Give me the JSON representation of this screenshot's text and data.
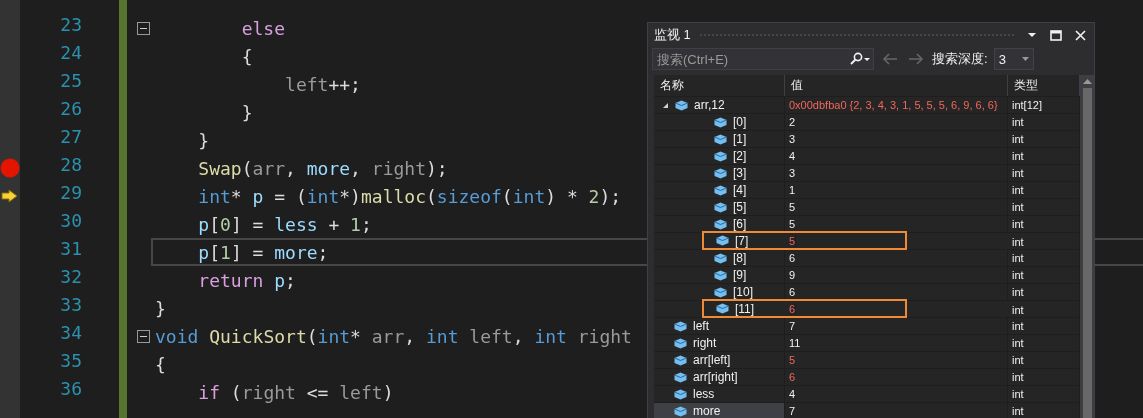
{
  "editor": {
    "lines": [
      {
        "number": "23",
        "breakpoint": false,
        "current": false,
        "focused": false,
        "collapsible": true,
        "tokens": [
          {
            "t": "        else",
            "kind": "ctl"
          }
        ]
      },
      {
        "number": "24",
        "breakpoint": false,
        "current": false,
        "focused": false,
        "collapsible": false,
        "tokens": [
          {
            "t": "        {",
            "kind": "plain"
          }
        ]
      },
      {
        "number": "25",
        "breakpoint": false,
        "current": false,
        "focused": false,
        "collapsible": false,
        "tokens": [
          {
            "t": "            left",
            "kind": "param"
          },
          {
            "t": "++;",
            "kind": "plain"
          }
        ]
      },
      {
        "number": "26",
        "breakpoint": false,
        "current": false,
        "focused": false,
        "collapsible": false,
        "tokens": [
          {
            "t": "        }",
            "kind": "plain"
          }
        ]
      },
      {
        "number": "27",
        "breakpoint": false,
        "current": false,
        "focused": false,
        "collapsible": false,
        "tokens": [
          {
            "t": "    }",
            "kind": "plain"
          }
        ]
      },
      {
        "number": "28",
        "breakpoint": true,
        "current": false,
        "focused": false,
        "collapsible": false,
        "tokens": [
          {
            "t": "    Swap",
            "kind": "fn"
          },
          {
            "t": "(",
            "kind": "plain"
          },
          {
            "t": "arr",
            "kind": "param"
          },
          {
            "t": ", ",
            "kind": "plain"
          },
          {
            "t": "more",
            "kind": "var"
          },
          {
            "t": ", ",
            "kind": "plain"
          },
          {
            "t": "right",
            "kind": "param"
          },
          {
            "t": ");",
            "kind": "plain"
          }
        ]
      },
      {
        "number": "29",
        "breakpoint": false,
        "current": true,
        "focused": false,
        "collapsible": false,
        "tokens": [
          {
            "t": "    int",
            "kind": "kw"
          },
          {
            "t": "* ",
            "kind": "plain"
          },
          {
            "t": "p",
            "kind": "var"
          },
          {
            "t": " = (",
            "kind": "plain"
          },
          {
            "t": "int",
            "kind": "kw"
          },
          {
            "t": "*)",
            "kind": "plain"
          },
          {
            "t": "malloc",
            "kind": "fn"
          },
          {
            "t": "(",
            "kind": "plain"
          },
          {
            "t": "sizeof",
            "kind": "kw"
          },
          {
            "t": "(",
            "kind": "plain"
          },
          {
            "t": "int",
            "kind": "kw"
          },
          {
            "t": ") * ",
            "kind": "plain"
          },
          {
            "t": "2",
            "kind": "num"
          },
          {
            "t": ");",
            "kind": "plain"
          }
        ]
      },
      {
        "number": "30",
        "breakpoint": false,
        "current": false,
        "focused": false,
        "collapsible": false,
        "tokens": [
          {
            "t": "    p",
            "kind": "var"
          },
          {
            "t": "[",
            "kind": "plain"
          },
          {
            "t": "0",
            "kind": "num"
          },
          {
            "t": "] = ",
            "kind": "plain"
          },
          {
            "t": "less",
            "kind": "var"
          },
          {
            "t": " + ",
            "kind": "plain"
          },
          {
            "t": "1",
            "kind": "num"
          },
          {
            "t": ";",
            "kind": "plain"
          }
        ]
      },
      {
        "number": "31",
        "breakpoint": false,
        "current": false,
        "focused": true,
        "collapsible": false,
        "tokens": [
          {
            "t": "    p",
            "kind": "var"
          },
          {
            "t": "[",
            "kind": "plain"
          },
          {
            "t": "1",
            "kind": "num"
          },
          {
            "t": "] = ",
            "kind": "plain"
          },
          {
            "t": "more",
            "kind": "var"
          },
          {
            "t": ";",
            "kind": "plain"
          }
        ]
      },
      {
        "number": "32",
        "breakpoint": false,
        "current": false,
        "focused": false,
        "collapsible": false,
        "tokens": [
          {
            "t": "    return",
            "kind": "ctl"
          },
          {
            "t": " p",
            "kind": "var"
          },
          {
            "t": ";",
            "kind": "plain"
          }
        ]
      },
      {
        "number": "33",
        "breakpoint": false,
        "current": false,
        "focused": false,
        "collapsible": false,
        "tokens": [
          {
            "t": "}",
            "kind": "plain"
          }
        ]
      },
      {
        "number": "34",
        "breakpoint": false,
        "current": false,
        "focused": false,
        "collapsible": true,
        "tokens": [
          {
            "t": "void",
            "kind": "kw"
          },
          {
            "t": " QuickSort",
            "kind": "fn"
          },
          {
            "t": "(",
            "kind": "plain"
          },
          {
            "t": "int",
            "kind": "kw"
          },
          {
            "t": "* ",
            "kind": "plain"
          },
          {
            "t": "arr",
            "kind": "param"
          },
          {
            "t": ", ",
            "kind": "plain"
          },
          {
            "t": "int",
            "kind": "kw"
          },
          {
            "t": " left",
            "kind": "param"
          },
          {
            "t": ", ",
            "kind": "plain"
          },
          {
            "t": "int",
            "kind": "kw"
          },
          {
            "t": " right",
            "kind": "param"
          }
        ]
      },
      {
        "number": "35",
        "breakpoint": false,
        "current": false,
        "focused": false,
        "collapsible": false,
        "tokens": [
          {
            "t": "{",
            "kind": "plain"
          }
        ]
      },
      {
        "number": "36",
        "breakpoint": false,
        "current": false,
        "focused": false,
        "collapsible": false,
        "tokens": [
          {
            "t": "    if",
            "kind": "ctl"
          },
          {
            "t": " (",
            "kind": "plain"
          },
          {
            "t": "right",
            "kind": "param"
          },
          {
            "t": " <= ",
            "kind": "plain"
          },
          {
            "t": "left",
            "kind": "param"
          },
          {
            "t": ")",
            "kind": "plain"
          }
        ]
      }
    ]
  },
  "watch": {
    "title": "监视 1",
    "search": {
      "placeholder": "搜索(Ctrl+E)"
    },
    "depth_label": "搜索深度:",
    "depth_value": "3",
    "columns": [
      "名称",
      "值",
      "类型"
    ],
    "rows": [
      {
        "name": "arr,12",
        "value": "0x00dbfba0 {2, 3, 4, 3, 1, 5, 5, 5, 6, 9, 6, 6}",
        "type": "int[12]",
        "changed": true,
        "highlighted": false,
        "selected": false,
        "expanded": true,
        "children": [
          {
            "name": "[0]",
            "value": "2",
            "type": "int",
            "changed": false,
            "highlighted": false,
            "selected": false
          },
          {
            "name": "[1]",
            "value": "3",
            "type": "int",
            "changed": false,
            "highlighted": false,
            "selected": false
          },
          {
            "name": "[2]",
            "value": "4",
            "type": "int",
            "changed": false,
            "highlighted": false,
            "selected": false
          },
          {
            "name": "[3]",
            "value": "3",
            "type": "int",
            "changed": false,
            "highlighted": false,
            "selected": false
          },
          {
            "name": "[4]",
            "value": "1",
            "type": "int",
            "changed": false,
            "highlighted": false,
            "selected": false
          },
          {
            "name": "[5]",
            "value": "5",
            "type": "int",
            "changed": false,
            "highlighted": false,
            "selected": false
          },
          {
            "name": "[6]",
            "value": "5",
            "type": "int",
            "changed": false,
            "highlighted": false,
            "selected": false
          },
          {
            "name": "[7]",
            "value": "5",
            "type": "int",
            "changed": true,
            "highlighted": true,
            "selected": false
          },
          {
            "name": "[8]",
            "value": "6",
            "type": "int",
            "changed": false,
            "highlighted": false,
            "selected": false
          },
          {
            "name": "[9]",
            "value": "9",
            "type": "int",
            "changed": false,
            "highlighted": false,
            "selected": false
          },
          {
            "name": "[10]",
            "value": "6",
            "type": "int",
            "changed": false,
            "highlighted": false,
            "selected": false
          },
          {
            "name": "[11]",
            "value": "6",
            "type": "int",
            "changed": true,
            "highlighted": true,
            "selected": false
          }
        ]
      },
      {
        "name": "left",
        "value": "7",
        "type": "int",
        "changed": false,
        "highlighted": false,
        "selected": false
      },
      {
        "name": "right",
        "value": "11",
        "type": "int",
        "changed": false,
        "highlighted": false,
        "selected": false
      },
      {
        "name": "arr[left]",
        "value": "5",
        "type": "int",
        "changed": true,
        "highlighted": false,
        "selected": false
      },
      {
        "name": "arr[right]",
        "value": "6",
        "type": "int",
        "changed": true,
        "highlighted": false,
        "selected": false
      },
      {
        "name": "less",
        "value": "4",
        "type": "int",
        "changed": false,
        "highlighted": false,
        "selected": false
      },
      {
        "name": "more",
        "value": "7",
        "type": "int",
        "changed": false,
        "highlighted": false,
        "selected": true
      }
    ]
  }
}
